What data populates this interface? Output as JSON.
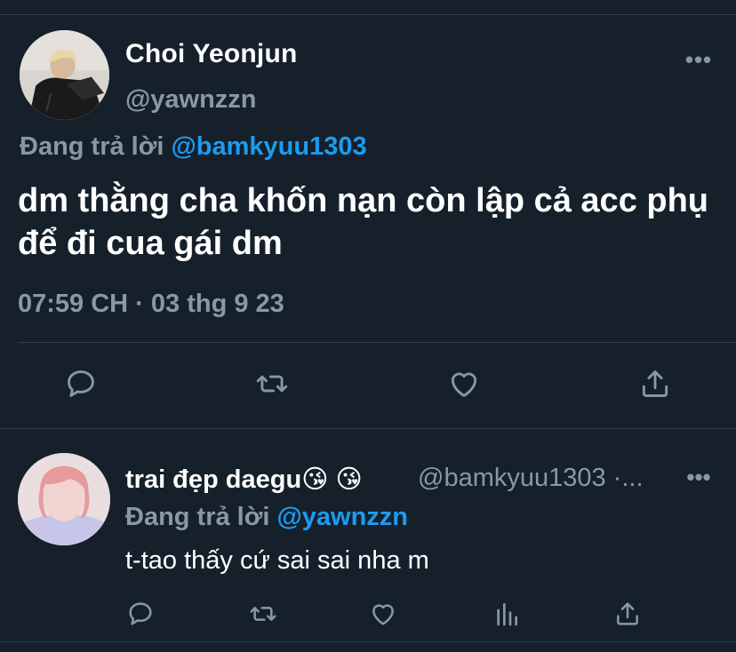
{
  "main_tweet": {
    "author_name": "Choi Yeonjun",
    "author_handle": "@yawnzzn",
    "replying_prefix": "Đang trả lời",
    "replying_to": "@bamkyuu1303",
    "text": "dm thằng cha khốn nạn còn lập cả acc phụ để đi cua gái dm",
    "timestamp": "07:59 CH · 03 thg 9 23",
    "more_label": "•••",
    "actions": [
      "reply-icon",
      "retweet-icon",
      "like-icon",
      "share-icon"
    ]
  },
  "reply_tweet": {
    "author_name": "trai đẹp daegu😘 😘",
    "author_handle": "@bamkyuu1303 ·...",
    "replying_prefix": "Đang trả lời",
    "replying_to": "@yawnzzn",
    "text": "t-tao thấy cứ sai sai nha m",
    "more_label": "•••",
    "actions": [
      "reply-icon",
      "retweet-icon",
      "like-icon",
      "analytics-icon",
      "share-icon"
    ]
  },
  "colors": {
    "background": "#15202b",
    "secondary_text": "#8899a6",
    "accent": "#1d9bf0",
    "divider": "#2f3b47"
  }
}
